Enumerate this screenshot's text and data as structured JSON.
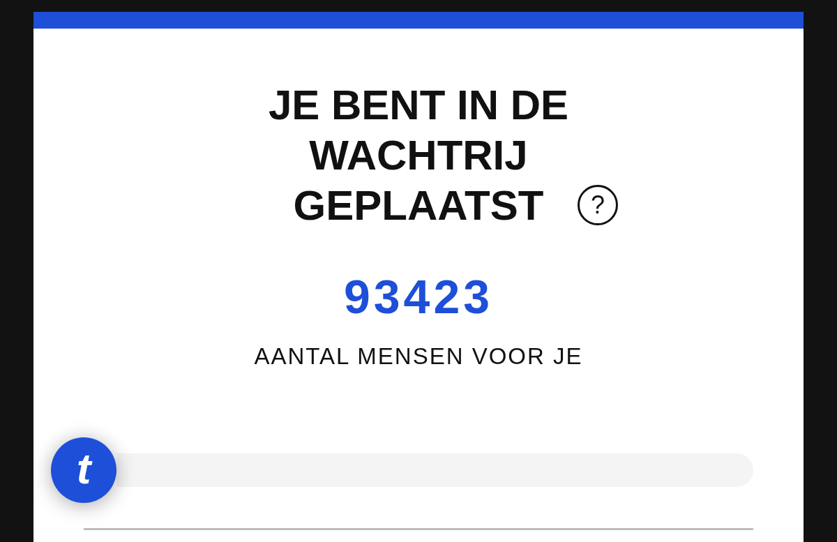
{
  "heading": {
    "text": "JE BENT IN DE WACHTRIJ GEPLAATST",
    "help_icon": "?"
  },
  "queue": {
    "count": "93423",
    "label": "AANTAL MENSEN VOOR JE"
  },
  "progress": {
    "level": 0,
    "marker_letter": "t"
  }
}
